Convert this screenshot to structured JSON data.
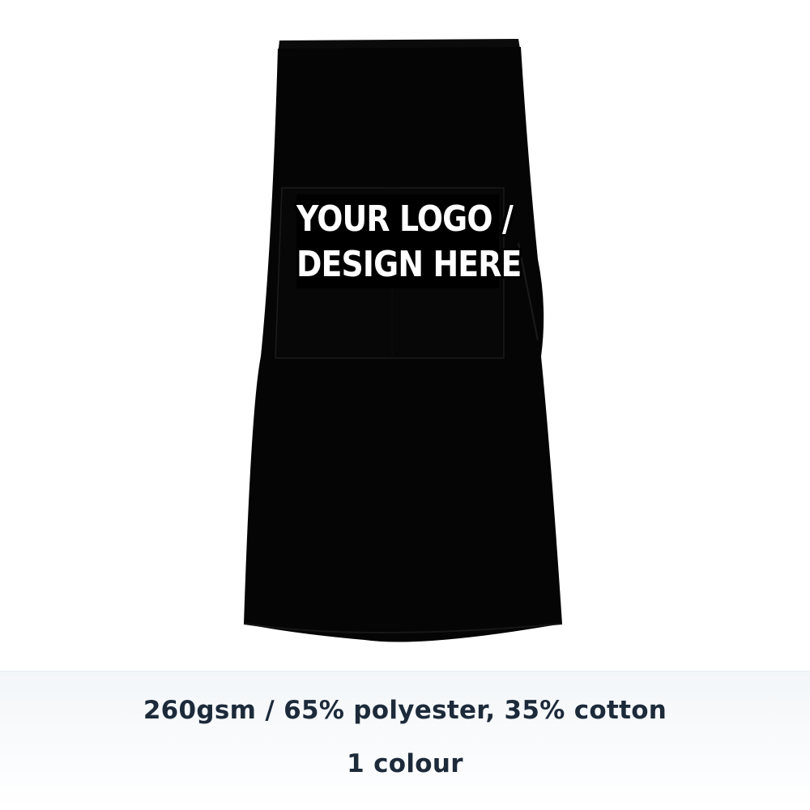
{
  "product": {
    "image_alt": "black half apron with pocket",
    "colors": {
      "apron": "#050505",
      "pocket_seam": "#151515",
      "logo_text": "#ffffff",
      "background": "#ffffff",
      "band_top": "#f3f6f9",
      "spec_text": "#1c2a3a"
    },
    "logo_placeholder": {
      "line1": "YOUR LOGO /",
      "line2": "DESIGN HERE"
    }
  },
  "specs": {
    "material": "260gsm / 65% polyester, 35% cotton",
    "colours": "1 colour"
  }
}
